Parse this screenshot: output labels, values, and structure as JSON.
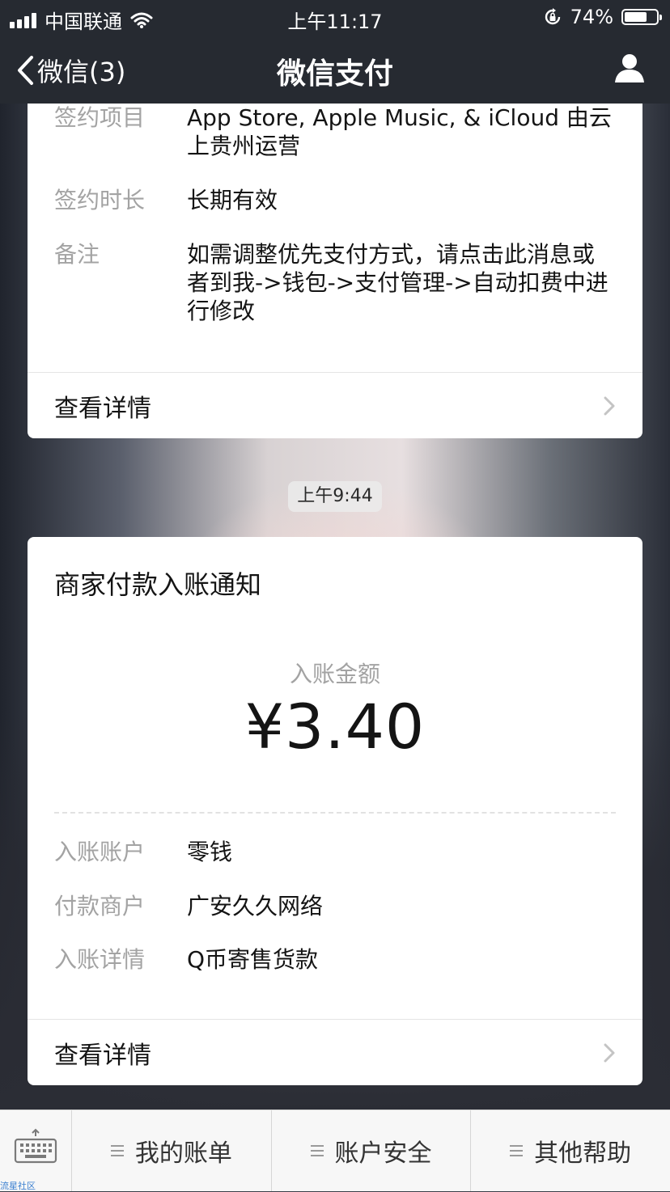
{
  "status_bar": {
    "carrier": "中国联通",
    "time": "上午11:17",
    "battery_percent": "74%",
    "battery_level": 0.74,
    "icons": [
      "signal-icon",
      "wifi-icon",
      "rotation-lock-icon",
      "battery-icon"
    ]
  },
  "nav": {
    "back_label": "微信(3)",
    "title": "微信支付",
    "profile_icon": "person-icon"
  },
  "card1": {
    "rows": [
      {
        "key": "签约项目",
        "value": "App Store, Apple Music, & iCloud 由云上贵州运营"
      },
      {
        "key": "签约时长",
        "value": "长期有效"
      },
      {
        "key": "备注",
        "value": "如需调整优先支付方式，请点击此消息或者到我->钱包->支付管理->自动扣费中进行修改"
      }
    ],
    "detail_label": "查看详情"
  },
  "timestamp": "上午9:44",
  "card2": {
    "title": "商家付款入账通知",
    "amount_label": "入账金额",
    "amount": "¥3.40",
    "rows": [
      {
        "key": "入账账户",
        "value": "零钱"
      },
      {
        "key": "付款商户",
        "value": "广安久久网络"
      },
      {
        "key": "入账详情",
        "value": "Q币寄售货款"
      }
    ],
    "detail_label": "查看详情"
  },
  "bottom_menu": {
    "keyboard_icon": "keyboard-icon",
    "items": [
      {
        "label": "我的账单"
      },
      {
        "label": "账户安全"
      },
      {
        "label": "其他帮助"
      }
    ]
  },
  "watermark": "流星社区",
  "colors": {
    "bar_bg": "#262a31",
    "card_bg": "#ffffff",
    "key_text": "#a3a3a3",
    "value_text": "#141414"
  }
}
